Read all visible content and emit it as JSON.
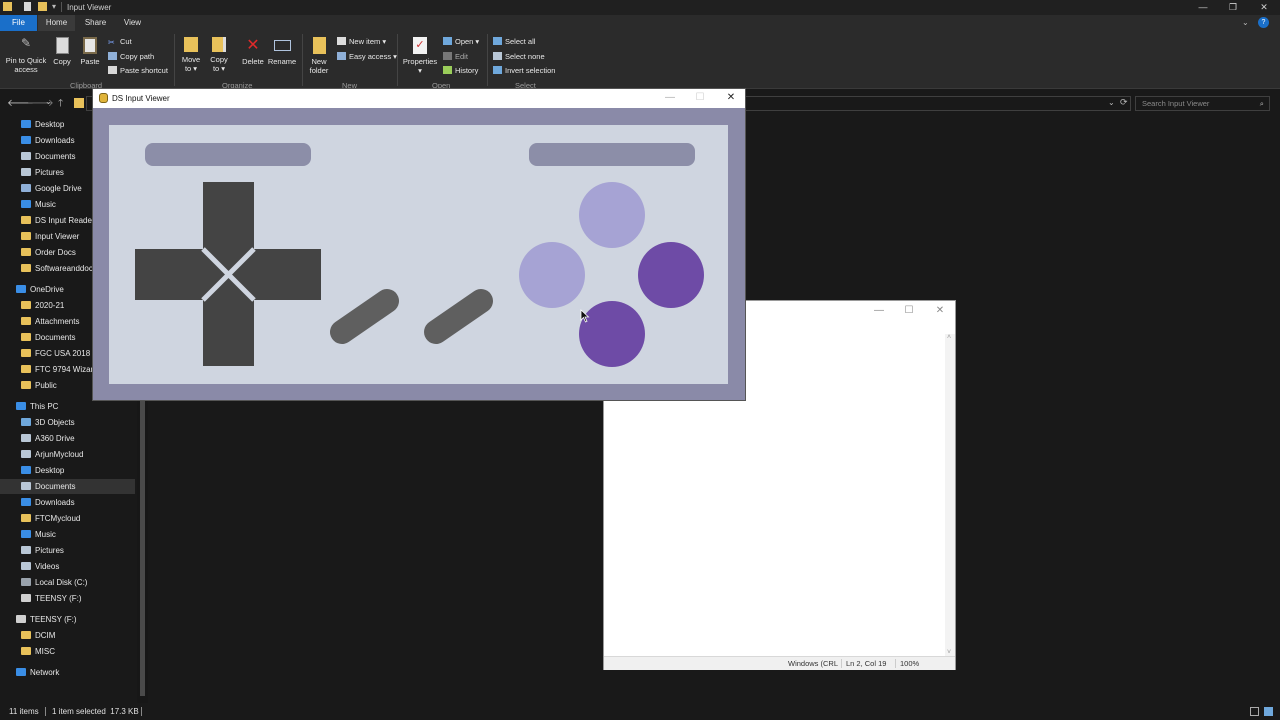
{
  "explorer": {
    "window_title": "Input Viewer",
    "tabs": [
      "File",
      "Home",
      "View"
    ],
    "ribbon": {
      "pin_label_1": "Pin to Quick",
      "pin_label_2": "access",
      "copy": "Copy",
      "paste": "Paste",
      "cut": "Cut",
      "copy_path": "Copy path",
      "paste_shortcut": "Paste shortcut",
      "move_to_1": "Move",
      "move_to_2": "to ▾",
      "copy_to_1": "Copy",
      "copy_to_2": "to ▾",
      "delete": "Delete",
      "rename": "Rename",
      "new_folder_1": "New",
      "new_folder_2": "folder",
      "new_item": "New item ▾",
      "easy_access": "Easy access ▾",
      "properties": "Properties",
      "open": "Open ▾",
      "edit": "Edit",
      "history": "History",
      "select_all": "Select all",
      "select_none": "Select none",
      "invert_selection": "Invert selection",
      "group_clipboard": "Clipboard",
      "group_organize": "Organize",
      "group_new": "New",
      "group_open": "Open",
      "group_select": "Select"
    },
    "search_placeholder": "Search Input Viewer",
    "sidebar": [
      {
        "label": "Desktop",
        "icon": "desktop-icon",
        "color": "#3a8ee6",
        "indent": 1
      },
      {
        "label": "Downloads",
        "icon": "download-icon",
        "color": "#3a8ee6",
        "indent": 1
      },
      {
        "label": "Documents",
        "icon": "documents-icon",
        "color": "#b9c7d6",
        "indent": 1
      },
      {
        "label": "Pictures",
        "icon": "pictures-icon",
        "color": "#b9c7d6",
        "indent": 1
      },
      {
        "label": "Google Drive",
        "icon": "google-drive-icon",
        "color": "#8fb0d8",
        "indent": 1
      },
      {
        "label": "Music",
        "icon": "music-icon",
        "color": "#3a8ee6",
        "indent": 1
      },
      {
        "label": "DS Input Reader",
        "icon": "folder-icon",
        "color": "#e8c15a",
        "indent": 1
      },
      {
        "label": "Input Viewer",
        "icon": "folder-icon",
        "color": "#e8c15a",
        "indent": 1
      },
      {
        "label": "Order Docs",
        "icon": "folder-icon",
        "color": "#e8c15a",
        "indent": 1
      },
      {
        "label": "Softwareanddoc",
        "icon": "folder-icon",
        "color": "#e8c15a",
        "indent": 1
      },
      {
        "label": "OneDrive",
        "icon": "onedrive-icon",
        "color": "#3a8ee6",
        "indent": 0,
        "gap": true
      },
      {
        "label": "2020-21",
        "icon": "folder-icon",
        "color": "#e8c15a",
        "indent": 1
      },
      {
        "label": "Attachments",
        "icon": "folder-icon",
        "color": "#e8c15a",
        "indent": 1
      },
      {
        "label": "Documents",
        "icon": "folder-icon",
        "color": "#e8c15a",
        "indent": 1
      },
      {
        "label": "FGC USA 2018",
        "icon": "folder-icon",
        "color": "#e8c15a",
        "indent": 1
      },
      {
        "label": "FTC 9794 Wizard",
        "icon": "folder-icon",
        "color": "#e8c15a",
        "indent": 1
      },
      {
        "label": "Public",
        "icon": "folder-icon",
        "color": "#e8c15a",
        "indent": 1
      },
      {
        "label": "This PC",
        "icon": "this-pc-icon",
        "color": "#3a8ee6",
        "indent": 0,
        "gap": true
      },
      {
        "label": "3D Objects",
        "icon": "3d-objects-icon",
        "color": "#6fa8dc",
        "indent": 1
      },
      {
        "label": "A360 Drive",
        "icon": "a360-drive-icon",
        "color": "#b9c7d6",
        "indent": 1
      },
      {
        "label": "ArjunMycloud",
        "icon": "cloud-drive-icon",
        "color": "#b9c7d6",
        "indent": 1
      },
      {
        "label": "Desktop",
        "icon": "desktop-icon",
        "color": "#3a8ee6",
        "indent": 1
      },
      {
        "label": "Documents",
        "icon": "documents-icon",
        "color": "#b9c7d6",
        "indent": 1,
        "selected": true
      },
      {
        "label": "Downloads",
        "icon": "download-icon",
        "color": "#3a8ee6",
        "indent": 1
      },
      {
        "label": "FTCMycloud",
        "icon": "folder-icon",
        "color": "#e8c15a",
        "indent": 1
      },
      {
        "label": "Music",
        "icon": "music-icon",
        "color": "#3a8ee6",
        "indent": 1
      },
      {
        "label": "Pictures",
        "icon": "pictures-icon",
        "color": "#b9c7d6",
        "indent": 1
      },
      {
        "label": "Videos",
        "icon": "videos-icon",
        "color": "#b9c7d6",
        "indent": 1
      },
      {
        "label": "Local Disk (C:)",
        "icon": "drive-icon",
        "color": "#9aa3ad",
        "indent": 1
      },
      {
        "label": "TEENSY (F:)",
        "icon": "usb-drive-icon",
        "color": "#d0d0d0",
        "indent": 1
      },
      {
        "label": "TEENSY (F:)",
        "icon": "usb-drive-icon",
        "color": "#d0d0d0",
        "indent": 0,
        "gap": true
      },
      {
        "label": "DCIM",
        "icon": "folder-icon",
        "color": "#e8c15a",
        "indent": 1
      },
      {
        "label": "MISC",
        "icon": "folder-icon",
        "color": "#e8c15a",
        "indent": 1
      },
      {
        "label": "Network",
        "icon": "network-icon",
        "color": "#3a8ee6",
        "indent": 0,
        "gap": true
      }
    ],
    "status": {
      "items": "11 items",
      "selected": "1 item selected  17.3 KB"
    }
  },
  "ds_viewer": {
    "title": "DS Input Viewer",
    "colors": {
      "frame": "#8a8aa8",
      "pad_bg": "#cfd5e0",
      "shoulder": "#8c8ea8",
      "dpad": "#444444",
      "select_start": "#5f5f5f",
      "button_light": "#a6a3d4",
      "button_dark": "#6e4ba6"
    }
  },
  "notepad": {
    "encoding": "Windows (CRL",
    "position": "Ln 2, Col 19",
    "zoom": "100%"
  }
}
